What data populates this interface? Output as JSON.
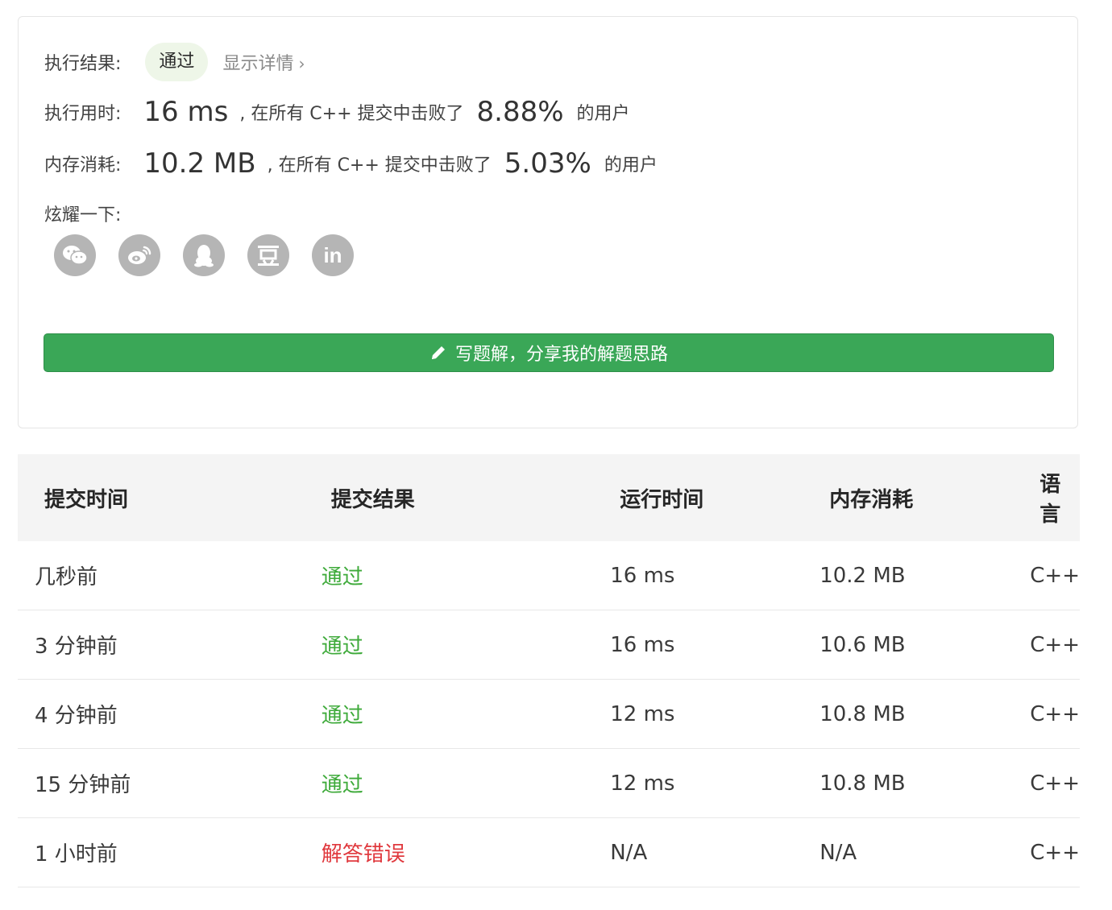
{
  "result": {
    "label": "执行结果:",
    "status": "通过",
    "details_link": "显示详情",
    "status_bg": "#eef6e8"
  },
  "runtime": {
    "label": "执行用时:",
    "value": "16 ms",
    "mid_text": ", 在所有 C++ 提交中击败了",
    "percent": "8.88%",
    "suffix": "的用户"
  },
  "memory": {
    "label": "内存消耗:",
    "value": "10.2 MB",
    "mid_text": ", 在所有 C++ 提交中击败了",
    "percent": "5.03%",
    "suffix": "的用户"
  },
  "share": {
    "label": "炫耀一下:",
    "icons": [
      "wechat-icon",
      "weibo-icon",
      "qq-icon",
      "douban-icon",
      "linkedin-icon"
    ]
  },
  "write_button": {
    "label": "写题解，分享我的解题思路",
    "color": "#3aa757"
  },
  "table": {
    "headers": [
      "提交时间",
      "提交结果",
      "运行时间",
      "内存消耗",
      "语言"
    ],
    "rows": [
      {
        "time": "几秒前",
        "result": "通过",
        "runtime": "16 ms",
        "memory": "10.2 MB",
        "lang": "C++",
        "status": "ok"
      },
      {
        "time": "3 分钟前",
        "result": "通过",
        "runtime": "16 ms",
        "memory": "10.6 MB",
        "lang": "C++",
        "status": "ok"
      },
      {
        "time": "4 分钟前",
        "result": "通过",
        "runtime": "12 ms",
        "memory": "10.8 MB",
        "lang": "C++",
        "status": "ok"
      },
      {
        "time": "15 分钟前",
        "result": "通过",
        "runtime": "12 ms",
        "memory": "10.8 MB",
        "lang": "C++",
        "status": "ok"
      },
      {
        "time": "1 小时前",
        "result": "解答错误",
        "runtime": "N/A",
        "memory": "N/A",
        "lang": "C++",
        "status": "err"
      }
    ],
    "colors": {
      "ok": "#3eaa3a",
      "err": "#e0393e"
    }
  }
}
